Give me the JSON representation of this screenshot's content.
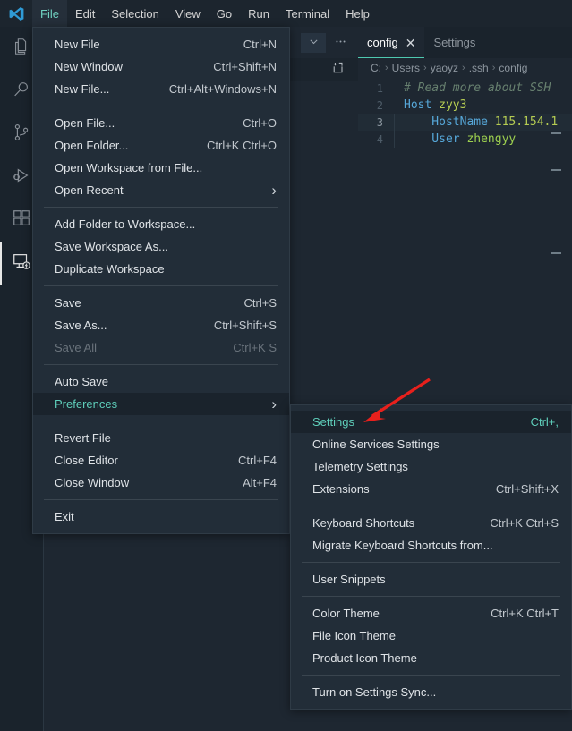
{
  "app": {
    "logo_icon": "vscode-logo-icon"
  },
  "menubar": {
    "items": [
      {
        "label": "File",
        "active": true
      },
      {
        "label": "Edit",
        "active": false
      },
      {
        "label": "Selection",
        "active": false
      },
      {
        "label": "View",
        "active": false
      },
      {
        "label": "Go",
        "active": false
      },
      {
        "label": "Run",
        "active": false
      },
      {
        "label": "Terminal",
        "active": false
      },
      {
        "label": "Help",
        "active": false
      }
    ]
  },
  "activitybar": {
    "items": [
      {
        "name": "explorer",
        "icon": "files-icon",
        "active": false
      },
      {
        "name": "search",
        "icon": "search-icon",
        "active": false
      },
      {
        "name": "source-control",
        "icon": "source-control-icon",
        "active": false
      },
      {
        "name": "run-and-debug",
        "icon": "run-debug-icon",
        "active": false
      },
      {
        "name": "extensions",
        "icon": "extensions-icon",
        "active": false
      },
      {
        "name": "remote-explorer",
        "icon": "remote-explorer-icon",
        "active": true
      }
    ]
  },
  "sidebar": {
    "collapse_icon": "chevron-down-icon",
    "more_icon": "more-actions-icon",
    "new-remote_icon": "new-remote-icon"
  },
  "editor": {
    "tabs": [
      {
        "label": "config",
        "active": true,
        "close_icon": "close-icon"
      },
      {
        "label": "Settings",
        "active": false
      }
    ],
    "breadcrumb": [
      "C:",
      "Users",
      "yaoyz",
      ".ssh",
      "config"
    ],
    "breadcrumb_separator": "›",
    "lines": [
      {
        "number": "1",
        "tokens": [
          {
            "text": "# Read more about SSH",
            "cls": "c-comment"
          }
        ],
        "current": false,
        "indent": false
      },
      {
        "number": "2",
        "tokens": [
          {
            "text": "Host ",
            "cls": "c-key"
          },
          {
            "text": "zyy3",
            "cls": "c-val"
          }
        ],
        "current": false,
        "indent": false
      },
      {
        "number": "3",
        "tokens": [
          {
            "text": "    HostName ",
            "cls": "c-key"
          },
          {
            "text": "115.154.1",
            "cls": "c-val"
          }
        ],
        "current": true,
        "indent": true
      },
      {
        "number": "4",
        "tokens": [
          {
            "text": "    User ",
            "cls": "c-key"
          },
          {
            "text": "zhengyy",
            "cls": "c-val2"
          }
        ],
        "current": false,
        "indent": true
      }
    ]
  },
  "file_menu": {
    "items": [
      {
        "type": "item",
        "label": "New File",
        "accel": "Ctrl+N"
      },
      {
        "type": "item",
        "label": "New Window",
        "accel": "Ctrl+Shift+N"
      },
      {
        "type": "item",
        "label": "New File...",
        "accel": "Ctrl+Alt+Windows+N"
      },
      {
        "type": "sep"
      },
      {
        "type": "item",
        "label": "Open File...",
        "accel": "Ctrl+O"
      },
      {
        "type": "item",
        "label": "Open Folder...",
        "accel": "Ctrl+K Ctrl+O"
      },
      {
        "type": "item",
        "label": "Open Workspace from File...",
        "accel": ""
      },
      {
        "type": "item",
        "label": "Open Recent",
        "accel": "",
        "submenu": true
      },
      {
        "type": "sep"
      },
      {
        "type": "item",
        "label": "Add Folder to Workspace...",
        "accel": ""
      },
      {
        "type": "item",
        "label": "Save Workspace As...",
        "accel": ""
      },
      {
        "type": "item",
        "label": "Duplicate Workspace",
        "accel": ""
      },
      {
        "type": "sep"
      },
      {
        "type": "item",
        "label": "Save",
        "accel": "Ctrl+S"
      },
      {
        "type": "item",
        "label": "Save As...",
        "accel": "Ctrl+Shift+S"
      },
      {
        "type": "item",
        "label": "Save All",
        "accel": "Ctrl+K S",
        "disabled": true
      },
      {
        "type": "sep"
      },
      {
        "type": "item",
        "label": "Auto Save",
        "accel": ""
      },
      {
        "type": "item",
        "label": "Preferences",
        "accel": "",
        "submenu": true,
        "highlight": true
      },
      {
        "type": "sep"
      },
      {
        "type": "item",
        "label": "Revert File",
        "accel": ""
      },
      {
        "type": "item",
        "label": "Close Editor",
        "accel": "Ctrl+F4"
      },
      {
        "type": "item",
        "label": "Close Window",
        "accel": "Alt+F4"
      },
      {
        "type": "sep"
      },
      {
        "type": "item",
        "label": "Exit",
        "accel": ""
      }
    ]
  },
  "preferences_menu": {
    "items": [
      {
        "type": "item",
        "label": "Settings",
        "accel": "Ctrl+,",
        "highlight": true
      },
      {
        "type": "item",
        "label": "Online Services Settings",
        "accel": ""
      },
      {
        "type": "item",
        "label": "Telemetry Settings",
        "accel": ""
      },
      {
        "type": "item",
        "label": "Extensions",
        "accel": "Ctrl+Shift+X"
      },
      {
        "type": "sep"
      },
      {
        "type": "item",
        "label": "Keyboard Shortcuts",
        "accel": "Ctrl+K Ctrl+S"
      },
      {
        "type": "item",
        "label": "Migrate Keyboard Shortcuts from...",
        "accel": ""
      },
      {
        "type": "sep"
      },
      {
        "type": "item",
        "label": "User Snippets",
        "accel": ""
      },
      {
        "type": "sep"
      },
      {
        "type": "item",
        "label": "Color Theme",
        "accel": "Ctrl+K Ctrl+T"
      },
      {
        "type": "item",
        "label": "File Icon Theme",
        "accel": ""
      },
      {
        "type": "item",
        "label": "Product Icon Theme",
        "accel": ""
      },
      {
        "type": "sep"
      },
      {
        "type": "item",
        "label": "Turn on Settings Sync...",
        "accel": ""
      }
    ]
  },
  "annotation": {
    "arrow_icon": "red-arrow-icon",
    "color": "#e8201c"
  },
  "colors": {
    "accent": "#4ec9b0",
    "menu_bg": "#222d38",
    "editor_bg": "#1e2731",
    "highlight_text": "#5fcfbb"
  }
}
